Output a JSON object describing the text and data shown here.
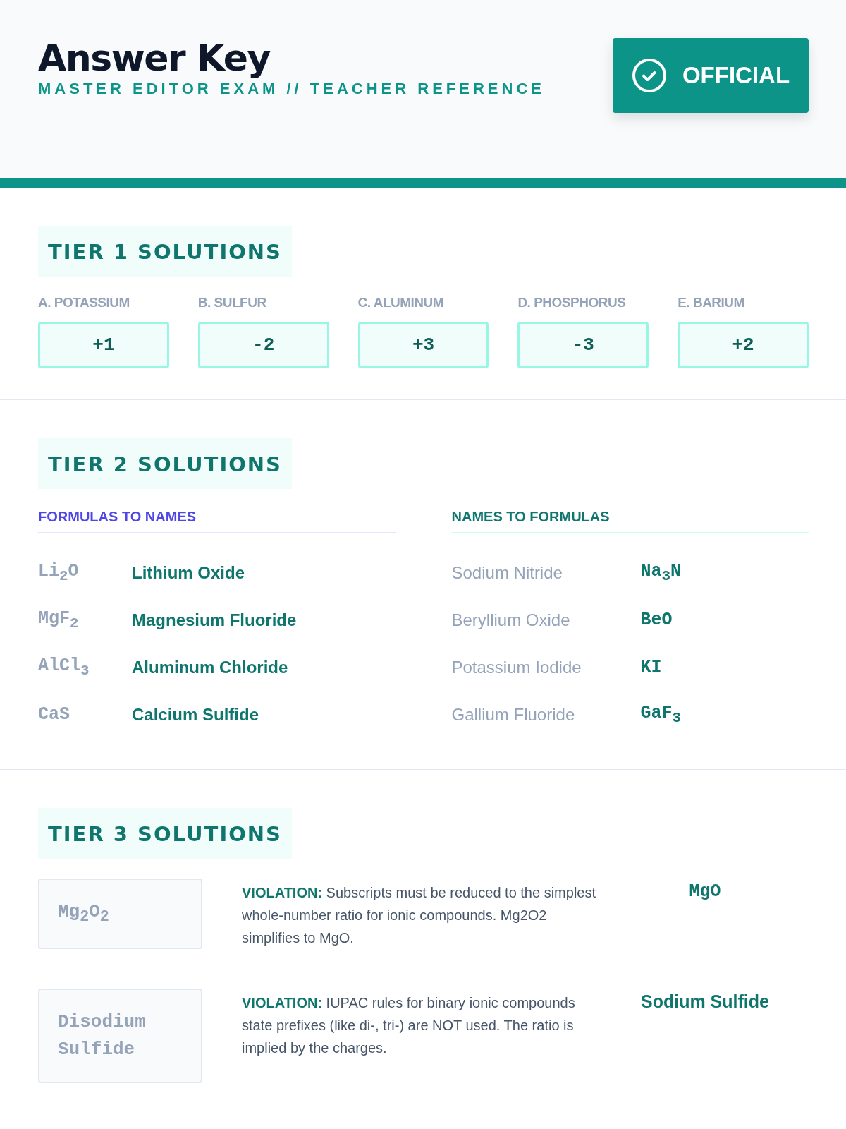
{
  "header": {
    "title": "Answer Key",
    "subtitle": "MASTER EDITOR EXAM // TEACHER REFERENCE",
    "badge": "OFFICIAL"
  },
  "tier1": {
    "heading": "TIER 1 SOLUTIONS",
    "items": [
      {
        "label": "A. POTASSIUM",
        "answer": "+1"
      },
      {
        "label": "B. SULFUR",
        "answer": "-2"
      },
      {
        "label": "C. ALUMINUM",
        "answer": "+3"
      },
      {
        "label": "D. PHOSPHORUS",
        "answer": "-3"
      },
      {
        "label": "E. BARIUM",
        "answer": "+2"
      }
    ]
  },
  "tier2": {
    "heading": "TIER 2 SOLUTIONS",
    "columns": [
      {
        "kind": "formula-to-name",
        "title": "FORMULAS TO NAMES",
        "rows": [
          {
            "question": "Li$_{2}$O",
            "answer": "Lithium Oxide"
          },
          {
            "question": "MgF$_{2}$",
            "answer": "Magnesium Fluoride"
          },
          {
            "question": "AlCl$_{3}$",
            "answer": "Aluminum Chloride"
          },
          {
            "question": "CaS",
            "answer": "Calcium Sulfide"
          }
        ]
      },
      {
        "kind": "name-to-formula",
        "title": "NAMES TO FORMULAS",
        "rows": [
          {
            "question": "Sodium Nitride",
            "answer": "Na$_{3}$N"
          },
          {
            "question": "Beryllium Oxide",
            "answer": "BeO"
          },
          {
            "question": "Potassium Iodide",
            "answer": "KI"
          },
          {
            "question": "Gallium Fluoride",
            "answer": "GaF$_{3}$"
          }
        ]
      }
    ]
  },
  "tier3": {
    "heading": "TIER 3 SOLUTIONS",
    "items": [
      {
        "wrong": "Mg$_{2}$O$_{2}$",
        "explanation": "**VIOLATION:** Subscripts must be reduced to the simplest whole-number ratio for ionic compounds. Mg2O2 simplifies to MgO.",
        "answer": "MgO",
        "kind": "formula"
      },
      {
        "wrong": "Disodium Sulfide",
        "explanation": "**VIOLATION:** IUPAC rules for binary ionic compounds state prefixes (like di-, tri-) are NOT used. The ratio is implied by the charges.",
        "answer": "Sodium Sulfide",
        "kind": "name"
      }
    ]
  }
}
